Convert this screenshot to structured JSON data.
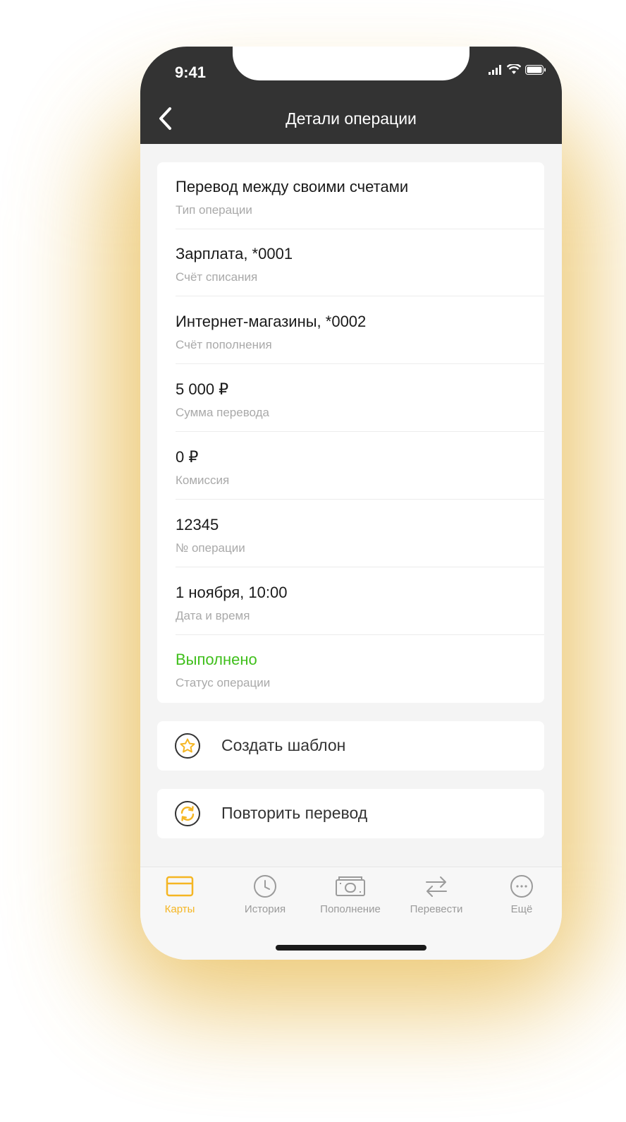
{
  "status_bar": {
    "time": "9:41"
  },
  "header": {
    "title": "Детали операции"
  },
  "details": [
    {
      "value": "Перевод между своими счетами",
      "label": "Тип операции"
    },
    {
      "value": "Зарплата, *0001",
      "label": "Счёт списания"
    },
    {
      "value": "Интернет-магазины, *0002",
      "label": "Счёт пополнения"
    },
    {
      "value": "5 000 ₽",
      "label": "Сумма перевода"
    },
    {
      "value": "0 ₽",
      "label": "Комиссия"
    },
    {
      "value": "12345",
      "label": "№ операции"
    },
    {
      "value": "1 ноября, 10:00",
      "label": "Дата и время"
    },
    {
      "value": "Выполнено",
      "label": "Статус операции"
    }
  ],
  "actions": {
    "create_template": "Создать шаблон",
    "repeat_transfer": "Повторить перевод"
  },
  "tabs": [
    {
      "label": "Карты",
      "icon": "card-icon",
      "active": true
    },
    {
      "label": "История",
      "icon": "clock-icon",
      "active": false
    },
    {
      "label": "Пополнение",
      "icon": "cash-icon",
      "active": false
    },
    {
      "label": "Перевести",
      "icon": "transfer-arrows-icon",
      "active": false
    },
    {
      "label": "Ещё",
      "icon": "more-dots-icon",
      "active": false
    }
  ],
  "colors": {
    "accent": "#f5b623",
    "status_success": "#3fbf1b",
    "header_bg": "#333333",
    "glow": "#e7b84a"
  }
}
